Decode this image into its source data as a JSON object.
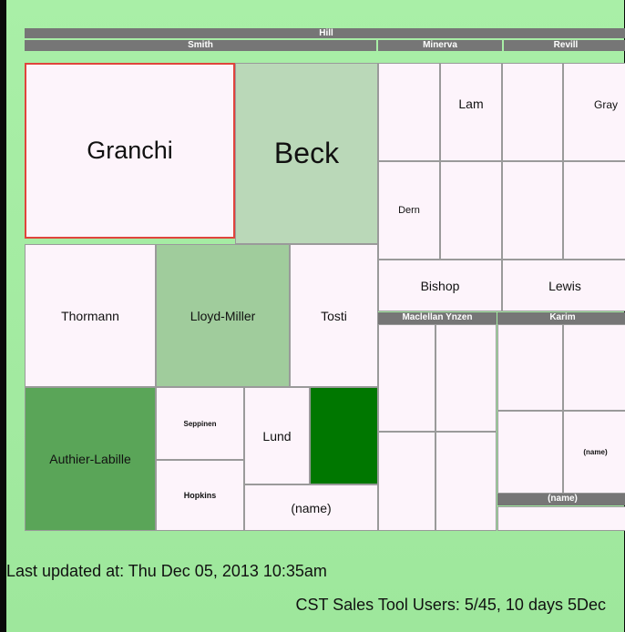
{
  "chart_data": {
    "type": "treemap",
    "root": "Hill",
    "groups": [
      {
        "name": "Smith",
        "items": [
          "Granchi",
          "Beck",
          "Thormann",
          "Lloyd-Miller",
          "Tosti",
          "Authier-Labille",
          "Seppinen",
          "Hopkins",
          "Lund",
          "(name)"
        ]
      },
      {
        "name": "Minerva",
        "items": [
          "Lam",
          "Dern",
          "Bishop"
        ]
      },
      {
        "name": "Revill",
        "items": [
          "Gray",
          "Lewis"
        ]
      },
      {
        "name": "Maclellan Ynzen",
        "items": []
      },
      {
        "name": "Karim",
        "items": [
          "(name)",
          "(name)"
        ]
      }
    ]
  },
  "colors": {
    "light": "#fdf4fb",
    "mid_green": "#bad8b8",
    "soft_green": "#a0cc9c",
    "strong_green": "#5aa558",
    "dark_green": "#007700",
    "header": "#767676",
    "selection": "#e0443c"
  },
  "headers": {
    "hill": "Hill",
    "smith": "Smith",
    "minerva": "Minerva",
    "revill": "Revill",
    "maclellan": "Maclellan Ynzen",
    "karim": "Karim",
    "karim_sub": "(name)"
  },
  "labels": {
    "granchi": "Granchi",
    "beck": "Beck",
    "lam": "Lam",
    "gray": "Gray",
    "dern": "Dern",
    "bishop": "Bishop",
    "lewis": "Lewis",
    "thormann": "Thormann",
    "lloyd_miller": "Lloyd-Miller",
    "tosti": "Tosti",
    "authier": "Authier-Labille",
    "seppinen": "Seppinen",
    "hopkins": "Hopkins",
    "lund": "Lund",
    "name_smith": "(name)",
    "name_karim": "(name)"
  },
  "footer": {
    "updated": "Last updated at: Thu Dec 05, 2013 10:35am",
    "users": "CST Sales Tool Users: 5/45, 10 days 5Dec"
  }
}
